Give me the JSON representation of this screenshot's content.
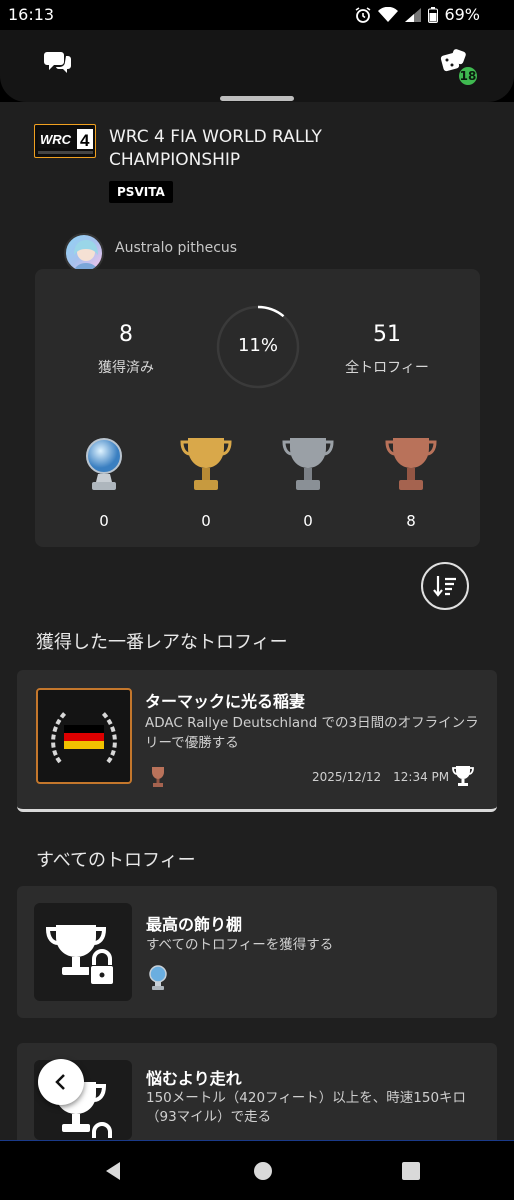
{
  "status": {
    "time": "16:13",
    "battery": "69%"
  },
  "header": {
    "notification_count": "18"
  },
  "game": {
    "logo_text": "WRC 4",
    "title": "WRC 4 FIA WORLD RALLY CHAMPIONSHIP",
    "platform": "PSVITA"
  },
  "user": {
    "name": "Australo pithecus"
  },
  "stats": {
    "earned_value": "8",
    "earned_label": "獲得済み",
    "progress_text": "11%",
    "progress_fraction": 0.11,
    "total_value": "51",
    "total_label": "全トロフィー",
    "counts": {
      "platinum": "0",
      "gold": "0",
      "silver": "0",
      "bronze": "8"
    }
  },
  "rarest": {
    "section_title": "獲得した一番レアなトロフィー",
    "name": "ターマックに光る稲妻",
    "description": "ADAC Rallye Deutschland での3日間のオフラインラリーで優勝する",
    "date": "2025/12/12　12:34 PM"
  },
  "all_trophies": {
    "section_title": "すべてのトロフィー",
    "items": [
      {
        "name": "最高の飾り棚",
        "description": "すべてのトロフィーを獲得する"
      },
      {
        "name": "悩むより走れ",
        "description": "150メートル（420フィート）以上を、時速150キロ（93マイル）で走る"
      }
    ]
  },
  "colors": {
    "accent_green": "#3fb950",
    "bronze": "#c4772c",
    "background": "#1f1f1f",
    "card": "#2c2c2c"
  }
}
